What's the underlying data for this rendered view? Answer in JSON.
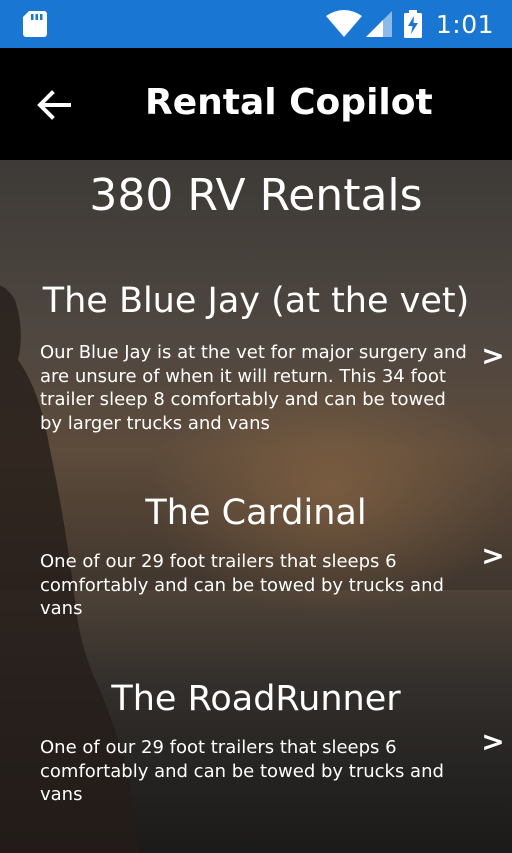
{
  "status_bar": {
    "time": "1:01",
    "icons": [
      "sd-card-icon",
      "wifi-icon",
      "cell-signal-icon",
      "battery-charging-icon"
    ]
  },
  "app_bar": {
    "title": "Rental Copilot",
    "back_icon": "arrow-back-icon"
  },
  "page": {
    "heading": "380 RV Rentals"
  },
  "rentals": [
    {
      "name": "The Blue Jay (at the vet)",
      "description": "Our Blue Jay is at the vet for major surgery and are unsure of when it will return. This 34 foot trailer sleep 8 comfortably and can be towed by larger trucks and vans",
      "chevron": ">"
    },
    {
      "name": "The Cardinal",
      "description": "One of our 29 foot trailers that sleeps 6 comfortably and can be towed by trucks and vans",
      "chevron": ">"
    },
    {
      "name": "The RoadRunner",
      "description": "One of our 29 foot trailers that sleeps 6 comfortably and can be towed by trucks and vans",
      "chevron": ">"
    }
  ],
  "colors": {
    "status_bar": "#1976d2",
    "app_bar": "#000000",
    "text": "#ffffff"
  }
}
